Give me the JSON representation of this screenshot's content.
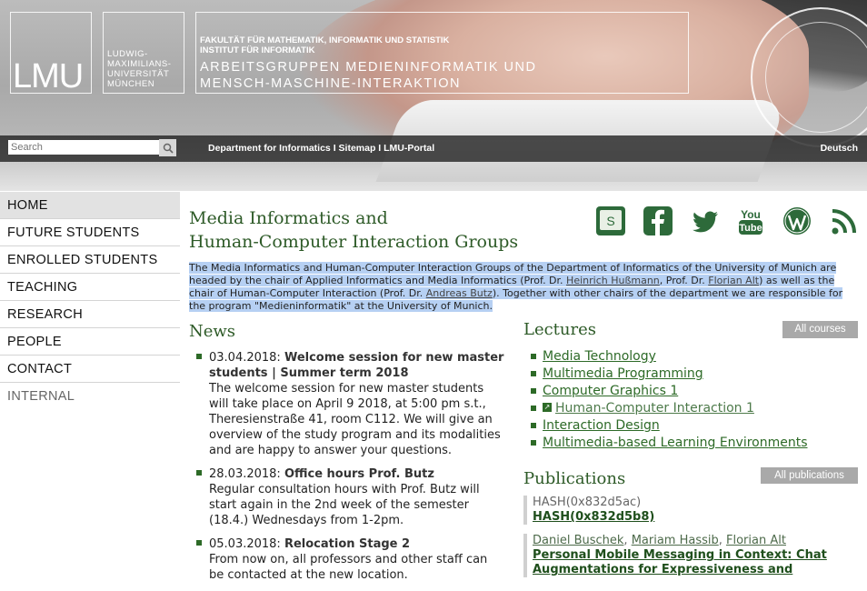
{
  "header": {
    "logo": "LMU",
    "university": [
      "LUDWIG-",
      "MAXIMILIANS-",
      "UNIVERSITÄT",
      "MÜNCHEN"
    ],
    "faculty": [
      "FAKULTÄT FÜR MATHEMATIK, INFORMATIK UND STATISTIK",
      "INSTITUT FÜR INFORMATIK"
    ],
    "groups": [
      "ARBEITSGRUPPEN MEDIENINFORMATIK UND",
      "MENSCH-MASCHINE-INTERAKTION"
    ]
  },
  "navbar": {
    "search_placeholder": "Search",
    "links": "Department for Informatics I Sitemap I LMU-Portal",
    "language": "Deutsch"
  },
  "sidebar": {
    "items": [
      {
        "label": "HOME"
      },
      {
        "label": "FUTURE STUDENTS"
      },
      {
        "label": "ENROLLED STUDENTS"
      },
      {
        "label": "TEACHING"
      },
      {
        "label": "RESEARCH"
      },
      {
        "label": "PEOPLE"
      },
      {
        "label": "CONTACT"
      },
      {
        "label": "INTERNAL"
      }
    ]
  },
  "main": {
    "title_line1": "Media Informatics and",
    "title_line2": "Human-Computer Interaction Groups",
    "social_icons": [
      "slideshare-icon",
      "facebook-icon",
      "twitter-icon",
      "youtube-icon",
      "wordpress-icon",
      "rss-icon"
    ],
    "intro": {
      "part1": "The Media Informatics and Human-Computer Interaction Groups of the Department of Informatics of the University of Munich are headed by the chair of Applied Informatics and Media Informatics (Prof. Dr. ",
      "link1": "Heinrich Hußmann",
      "part2": ", Prof. Dr. ",
      "link2": "Florian Alt",
      "part3": ") as well as the chair of Human-Computer Interaction (Prof. Dr. ",
      "link3": "Andreas Butz",
      "part4": "). Together with other chairs of the department we are responsible for the program \"Medieninformatik\" at the University of Munich."
    }
  },
  "news": {
    "heading": "News",
    "items": [
      {
        "date": "03.04.2018:",
        "title": "Welcome session for new master students | Summer term 2018",
        "body": "The welcome session for new master students will take place on April 9 2018, at 5:00 pm s.t., Theresienstraße 41, room C112. We will give an overview of the study program and its modalities and are happy to answer your questions."
      },
      {
        "date": "28.03.2018:",
        "title": "Office hours Prof. Butz",
        "body": "Regular consultation hours with Prof. Butz will start again in the 2nd week of the semester (18.4.) Wednesdays from 1-2pm."
      },
      {
        "date": "05.03.2018:",
        "title": "Relocation Stage 2",
        "body": "From now on, all professors and other staff can be contacted at the new location."
      }
    ]
  },
  "lectures": {
    "heading": "Lectures",
    "all_label": "All courses",
    "items": [
      {
        "label": "Media Technology"
      },
      {
        "label": "Multimedia Programming"
      },
      {
        "label": "Computer Graphics 1"
      },
      {
        "label": "Human-Computer Interaction 1"
      },
      {
        "label": "Interaction Design"
      },
      {
        "label": "Multimedia-based Learning Environments"
      }
    ]
  },
  "publications": {
    "heading": "Publications",
    "all_label": "All publications",
    "items": [
      {
        "authors_plain": "HASH(0x832d5ac)",
        "title": "HASH(0x832d5b8)"
      },
      {
        "author1": "Daniel Buschek",
        "sep1": ", ",
        "author2": "Mariam Hassib",
        "sep2": ", ",
        "author3": "Florian Alt",
        "title": "Personal Mobile Messaging in Context: Chat Augmentations for Expressiveness and"
      }
    ]
  },
  "colors": {
    "accent_green": "#2d5a27",
    "highlight": "#b6d0f3"
  }
}
